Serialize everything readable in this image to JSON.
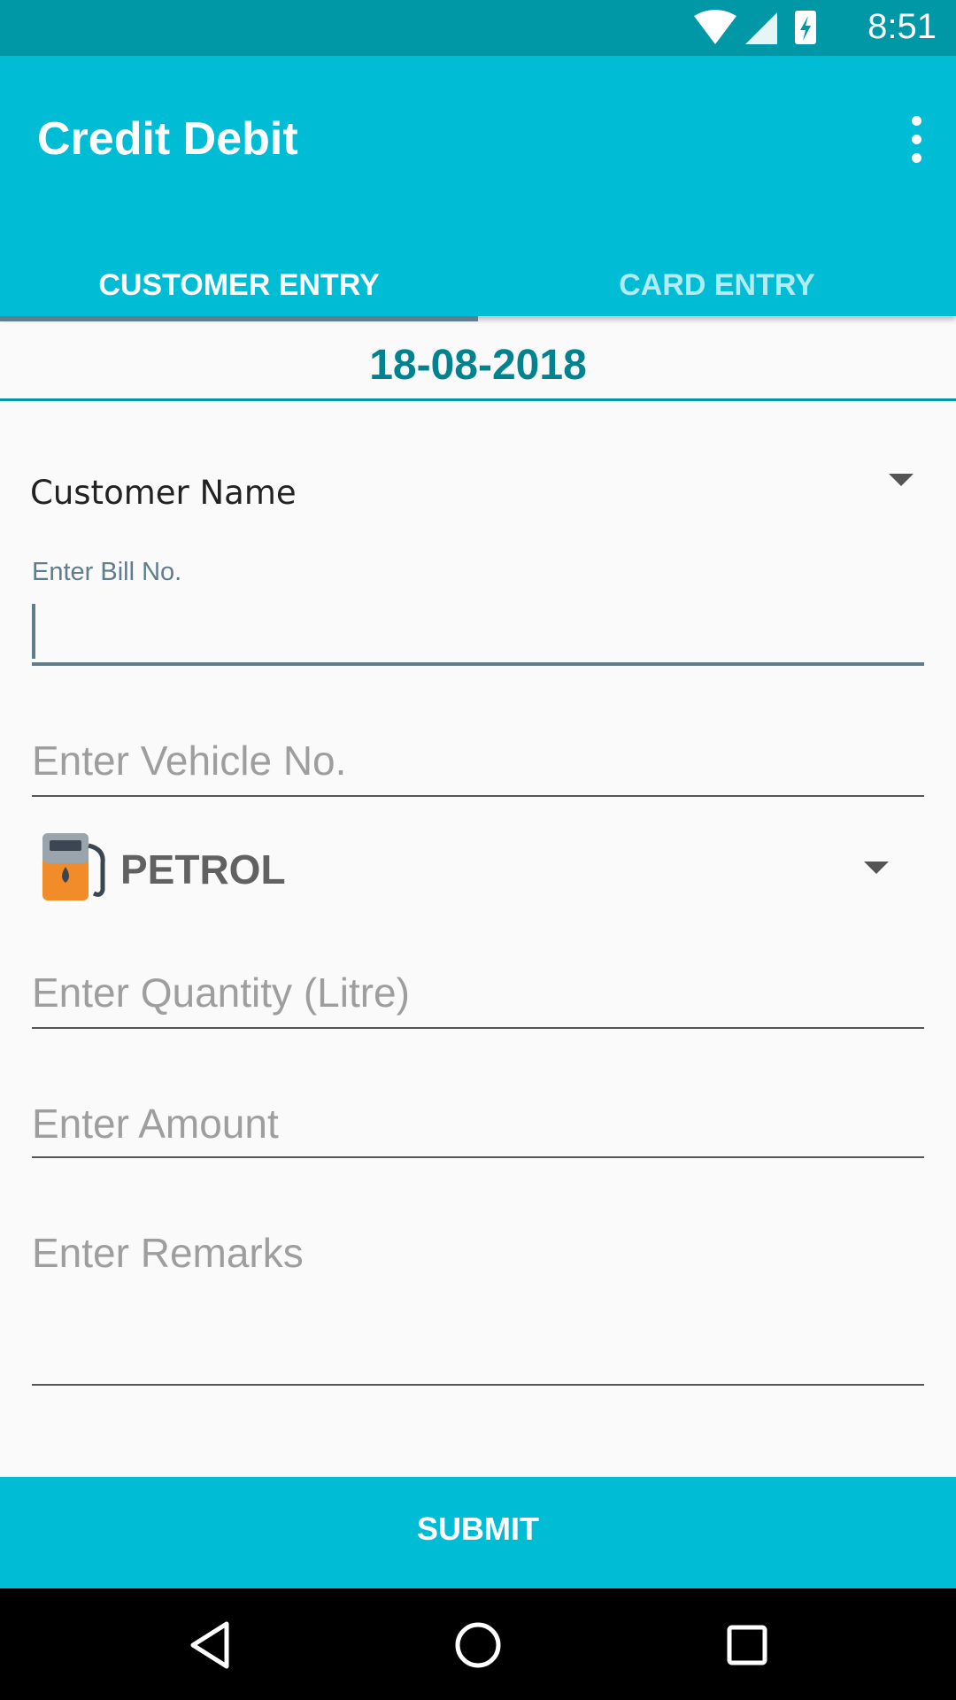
{
  "status_bar": {
    "time": "8:51"
  },
  "app_bar": {
    "title": "Credit Debit"
  },
  "tabs": [
    {
      "label": "CUSTOMER ENTRY",
      "active": true
    },
    {
      "label": "CARD ENTRY",
      "active": false
    }
  ],
  "form": {
    "date": "18-08-2018",
    "customer_spinner": {
      "label": "Customer Name"
    },
    "bill_no": {
      "float_label": "Enter Bill No.",
      "value": ""
    },
    "vehicle_no": {
      "placeholder": "Enter Vehicle No."
    },
    "fuel_type": {
      "selected": "PETROL",
      "icon": "fuel-pump-icon"
    },
    "quantity": {
      "placeholder": "Enter Quantity (Litre)"
    },
    "amount": {
      "placeholder": "Enter Amount"
    },
    "remarks": {
      "placeholder": "Enter Remarks"
    },
    "submit_label": "SUBMIT"
  },
  "colors": {
    "primary": "#00bcd4",
    "primary_dark": "#0097a7",
    "date_text": "#00838f",
    "accent_line": "#607d8b"
  }
}
